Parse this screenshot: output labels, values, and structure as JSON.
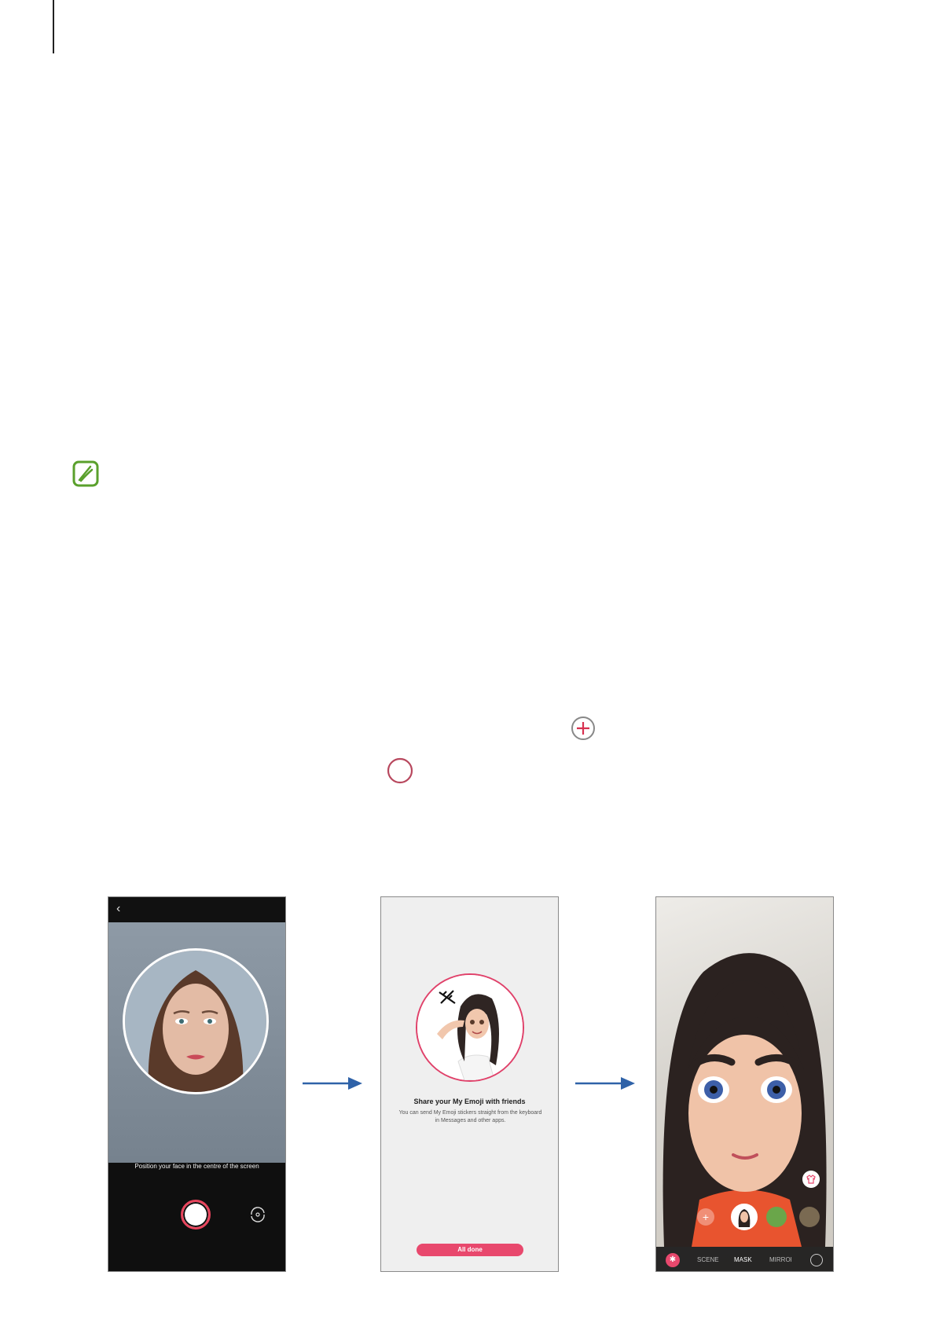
{
  "screen1": {
    "hint_text": "Position your face in the centre of the screen"
  },
  "screen2": {
    "title": "Share your My Emoji with friends",
    "body": "You can send My Emoji stickers straight from the keyboard in Messages and other apps.",
    "button_label": "All done"
  },
  "screen3": {
    "modes": [
      "SCENE",
      "MASK",
      "MIRROR"
    ],
    "active_mode": "MASK"
  },
  "colors": {
    "accent": "#e8486d",
    "note_icon": "#5aa02c",
    "arrow": "#2f62a8"
  },
  "icons": [
    "note-icon",
    "add-circle-icon",
    "record-circle-icon",
    "back-icon",
    "camera-switch-icon",
    "stickers-icon",
    "clothes-icon"
  ]
}
